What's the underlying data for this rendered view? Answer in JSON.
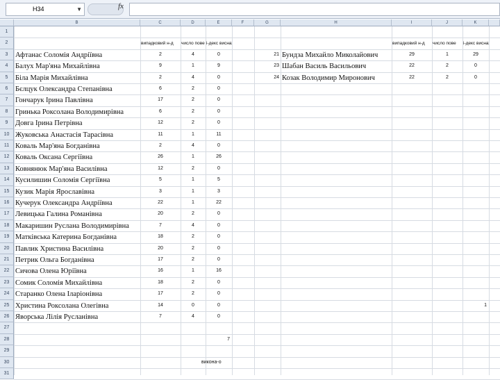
{
  "formula_bar": {
    "cell_ref": "H34",
    "fx": "fx",
    "formula": ""
  },
  "columns": [
    "B",
    "C",
    "D",
    "E",
    "F",
    "G",
    "H",
    "I",
    "J",
    "K"
  ],
  "rows": [
    "1",
    "2",
    "3",
    "4",
    "5",
    "6",
    "7",
    "8",
    "9",
    "10",
    "11",
    "12",
    "13",
    "14",
    "15",
    "16",
    "17",
    "18",
    "19",
    "20",
    "21",
    "22",
    "23",
    "24",
    "25",
    "26",
    "27",
    "28",
    "29",
    "30",
    "31"
  ],
  "headers": {
    "left": [
      "випадковий н-д",
      "число пове",
      "і-декс виснаж"
    ],
    "right": [
      "випадковий н-д",
      "число пове",
      "і-декс виснаж"
    ]
  },
  "left_table": [
    {
      "name": "Афтанас Соломія Андріївна",
      "c": "2",
      "d": "4",
      "e": "0"
    },
    {
      "name": "Балух Мар'яна Михайлівна",
      "c": "9",
      "d": "1",
      "e": "9"
    },
    {
      "name": "Біла Марія Михайлівна",
      "c": "2",
      "d": "4",
      "e": "0"
    },
    {
      "name": "Бєлцук Олександра Степанівна",
      "c": "6",
      "d": "2",
      "e": "0"
    },
    {
      "name": "Гончарук Ірина Павлівна",
      "c": "17",
      "d": "2",
      "e": "0"
    },
    {
      "name": "Гринька Роксолана Володимирівна",
      "c": "6",
      "d": "2",
      "e": "0"
    },
    {
      "name": "Довга Ірина Петрівна",
      "c": "12",
      "d": "2",
      "e": "0"
    },
    {
      "name": "Жуковська Анастасія Тарасівна",
      "c": "11",
      "d": "1",
      "e": "11"
    },
    {
      "name": "Коваль Мар'яна Богданівна",
      "c": "2",
      "d": "4",
      "e": "0"
    },
    {
      "name": "Коваль Оксана Сергіївна",
      "c": "26",
      "d": "1",
      "e": "26"
    },
    {
      "name": "Ковнянюк Мар'яна Василівна",
      "c": "12",
      "d": "2",
      "e": "0"
    },
    {
      "name": "Кусилишин Соломія Сергіївна",
      "c": "5",
      "d": "1",
      "e": "5"
    },
    {
      "name": "Кузик Марія Ярославівна",
      "c": "3",
      "d": "1",
      "e": "3"
    },
    {
      "name": "Кучерук Олександра Андріївна",
      "c": "22",
      "d": "1",
      "e": "22"
    },
    {
      "name": "Левицька Галина Романівна",
      "c": "20",
      "d": "2",
      "e": "0"
    },
    {
      "name": "Макаришин Руслана Володимирівна",
      "c": "7",
      "d": "4",
      "e": "0"
    },
    {
      "name": "Матківська Катерина Богданівна",
      "c": "18",
      "d": "2",
      "e": "0"
    },
    {
      "name": "Павлик Христина Василівна",
      "c": "20",
      "d": "2",
      "e": "0"
    },
    {
      "name": "Петрик Ольга Богданівна",
      "c": "17",
      "d": "2",
      "e": "0"
    },
    {
      "name": "Сичова Олена Юріївна",
      "c": "16",
      "d": "1",
      "e": "16"
    },
    {
      "name": "Сомик Соломія Михайлівна",
      "c": "18",
      "d": "2",
      "e": "0"
    },
    {
      "name": "Старанко Олена Іларіонівна",
      "c": "17",
      "d": "2",
      "e": "0"
    },
    {
      "name": "Христина Роксолана Олегівна",
      "c": "14",
      "d": "0",
      "e": "0"
    },
    {
      "name": "Яворська Лілія Русланівна",
      "c": "7",
      "d": "4",
      "e": "0"
    }
  ],
  "right_table": [
    {
      "g": "21",
      "name": "Бундза Михайло Миколайович",
      "i": "29",
      "j": "1",
      "k": "29"
    },
    {
      "g": "23",
      "name": "Шабан Василь Васильович",
      "i": "22",
      "j": "2",
      "k": "0"
    },
    {
      "g": "24",
      "name": "Козак Володимир Миронович",
      "i": "22",
      "j": "2",
      "k": "0"
    }
  ],
  "misc": {
    "e28": "7",
    "k25": "1",
    "label30": "викона-о"
  }
}
